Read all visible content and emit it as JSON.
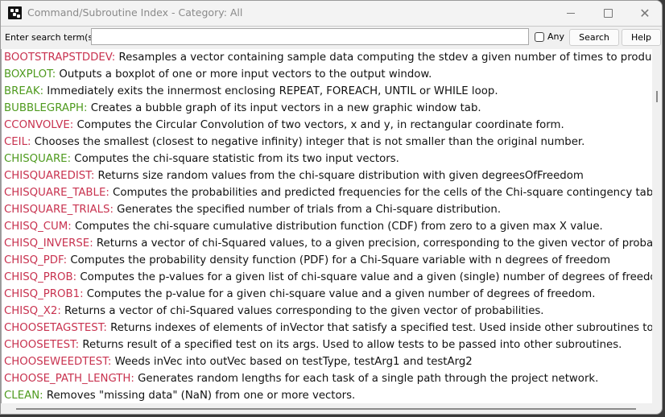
{
  "window": {
    "title": "Command/Subroutine Index - Category: All",
    "controls": {
      "minimize": "minimize",
      "maximize": "maximize",
      "close": "close"
    }
  },
  "search": {
    "label": "Enter search term(s):",
    "value": "",
    "placeholder": "",
    "any_label": "Any",
    "any_checked": false,
    "search_button": "Search",
    "help_button": "Help"
  },
  "colors": {
    "command_red": "#c8324f",
    "command_green": "#4e9a1e",
    "description": "#111111"
  },
  "entries": [
    {
      "name": "BOOTSTRAPSTDDEV:",
      "color": "red",
      "desc": " Resamples a vector containing sample data computing the stdev a given number of times to produc"
    },
    {
      "name": "BOXPLOT:",
      "color": "green",
      "desc": " Outputs a boxplot of one or more input vectors to the output window."
    },
    {
      "name": "BREAK:",
      "color": "green",
      "desc": " Immediately exits the innermost enclosing REPEAT, FOREACH, UNTIL or WHILE loop."
    },
    {
      "name": "BUBBLEGRAPH:",
      "color": "green",
      "desc": " Creates a bubble graph of its input vectors in a new graphic window tab."
    },
    {
      "name": "CCONVOLVE:",
      "color": "red",
      "desc": " Computes the Circular Convolution of two vectors, x and y, in rectangular coordinate form."
    },
    {
      "name": "CEIL:",
      "color": "red",
      "desc": " Chooses the smallest (closest to negative infinity) integer that is not smaller than the original number."
    },
    {
      "name": "CHISQUARE:",
      "color": "green",
      "desc": " Computes the chi-square statistic from its two input vectors."
    },
    {
      "name": "CHISQUAREDIST:",
      "color": "red",
      "desc": " Returns size random values from the chi-square distribution with given degreesOfFreedom"
    },
    {
      "name": "CHISQUARE_TABLE:",
      "color": "red",
      "desc": " Computes the probabilities and predicted frequencies for the cells of the Chi-square contingency table."
    },
    {
      "name": "CHISQUARE_TRIALS:",
      "color": "red",
      "desc": " Generates the specified number of trials from a Chi-square distribution."
    },
    {
      "name": "CHISQ_CUM:",
      "color": "red",
      "desc": " Computes the chi-square cumulative distribution function (CDF) from zero to a given max X value."
    },
    {
      "name": "CHISQ_INVERSE:",
      "color": "red",
      "desc": " Returns a vector of chi-Squared values, to a given precision, corresponding to the given vector of probab"
    },
    {
      "name": "CHISQ_PDF:",
      "color": "red",
      "desc": " Computes the probability density function (PDF) for a Chi-Square variable with n degrees of freedom"
    },
    {
      "name": "CHISQ_PROB:",
      "color": "red",
      "desc": " Computes the p-values for a given list of chi-square value and a given (single) number of degrees of freedo"
    },
    {
      "name": "CHISQ_PROB1:",
      "color": "red",
      "desc": " Computes the p-value for a given chi-square value and a given number of degrees of freedom."
    },
    {
      "name": "CHISQ_X2:",
      "color": "red",
      "desc": " Returns a vector of chi-Squared values corresponding to the given vector of probabilities."
    },
    {
      "name": "CHOOSETAGSTEST:",
      "color": "red",
      "desc": " Returns indexes of elements of inVector that satisfy a specified test. Used inside other subroutines to"
    },
    {
      "name": "CHOOSETEST:",
      "color": "red",
      "desc": " Returns result of a specified test on its args. Used to allow tests to be passed into other subroutines."
    },
    {
      "name": "CHOOSEWEEDTEST:",
      "color": "red",
      "desc": " Weeds inVec into outVec based on testType, testArg1 and testArg2"
    },
    {
      "name": "CHOOSE_PATH_LENGTH:",
      "color": "red",
      "desc": " Generates random lengths for each task of a single path through the project network."
    },
    {
      "name": "CLEAN:",
      "color": "green",
      "desc": " Removes \"missing data\" (NaN) from one or more vectors."
    }
  ],
  "scroll": {
    "vertical_position_fraction": 0.1,
    "horizontal_position_fraction": 0.0
  }
}
